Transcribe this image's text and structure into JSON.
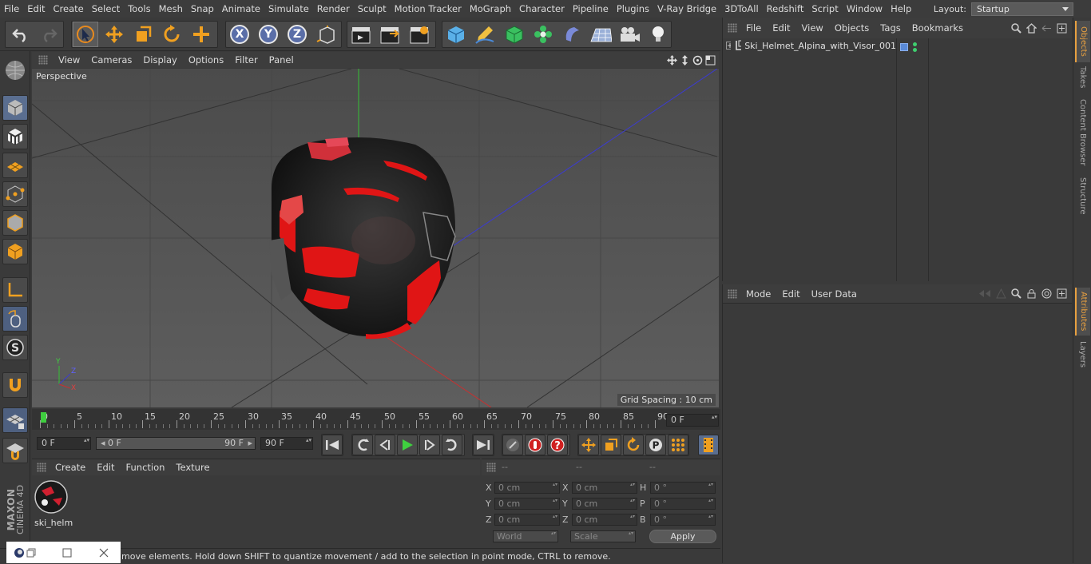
{
  "menubar": {
    "items": [
      "File",
      "Edit",
      "Create",
      "Select",
      "Tools",
      "Mesh",
      "Snap",
      "Animate",
      "Simulate",
      "Render",
      "Sculpt",
      "Motion Tracker",
      "MoGraph",
      "Character",
      "Pipeline",
      "Plugins",
      "V-Ray Bridge",
      "3DToAll",
      "Redshift",
      "Script",
      "Window",
      "Help"
    ],
    "layout_label": "Layout:",
    "layout_value": "Startup"
  },
  "viewport": {
    "menu": [
      "View",
      "Cameras",
      "Display",
      "Options",
      "Filter",
      "Panel"
    ],
    "label": "Perspective",
    "grid_spacing": "Grid Spacing : 10 cm",
    "axis": {
      "y": "Y",
      "z": "Z",
      "x": "X"
    }
  },
  "timeline": {
    "ticks": [
      "0",
      "5",
      "10",
      "15",
      "20",
      "25",
      "30",
      "35",
      "40",
      "45",
      "50",
      "55",
      "60",
      "65",
      "70",
      "75",
      "80",
      "85",
      "90"
    ],
    "current_frame": "0 F"
  },
  "transport": {
    "start": "0 F",
    "range_start": "0 F",
    "range_end": "90 F",
    "end": "90 F"
  },
  "material_manager": {
    "menu": [
      "Create",
      "Edit",
      "Function",
      "Texture"
    ],
    "material_name": "ski_helm"
  },
  "coordinates": {
    "headers": [
      "--",
      "--",
      "--"
    ],
    "rows": [
      {
        "l1": "X",
        "v1": "0 cm",
        "l2": "X",
        "v2": "0 cm",
        "l3": "H",
        "v3": "0 °"
      },
      {
        "l1": "Y",
        "v1": "0 cm",
        "l2": "Y",
        "v2": "0 cm",
        "l3": "P",
        "v3": "0 °"
      },
      {
        "l1": "Z",
        "v1": "0 cm",
        "l2": "Z",
        "v2": "0 cm",
        "l3": "B",
        "v3": "0 °"
      }
    ],
    "mode_world": "World",
    "mode_scale": "Scale",
    "apply": "Apply"
  },
  "status": "move elements. Hold down SHIFT to quantize movement / add to the selection in point mode, CTRL to remove.",
  "object_manager": {
    "menu": [
      "File",
      "Edit",
      "View",
      "Objects",
      "Tags",
      "Bookmarks"
    ],
    "object_name": "Ski_Helmet_Alpina_with_Visor_001"
  },
  "attributes": {
    "menu": [
      "Mode",
      "Edit",
      "User Data"
    ]
  },
  "right_tabs": [
    "Objects",
    "Takes",
    "Content Browser",
    "Structure",
    "Attributes",
    "Layers"
  ],
  "brand": {
    "maxon": "MAXON",
    "cinema": "CINEMA 4D"
  },
  "colors": {
    "accent": "#e8a040",
    "helmet_red": "#e01515",
    "axis_x": "#c03030",
    "axis_y": "#30b030",
    "axis_z": "#3030c0"
  }
}
